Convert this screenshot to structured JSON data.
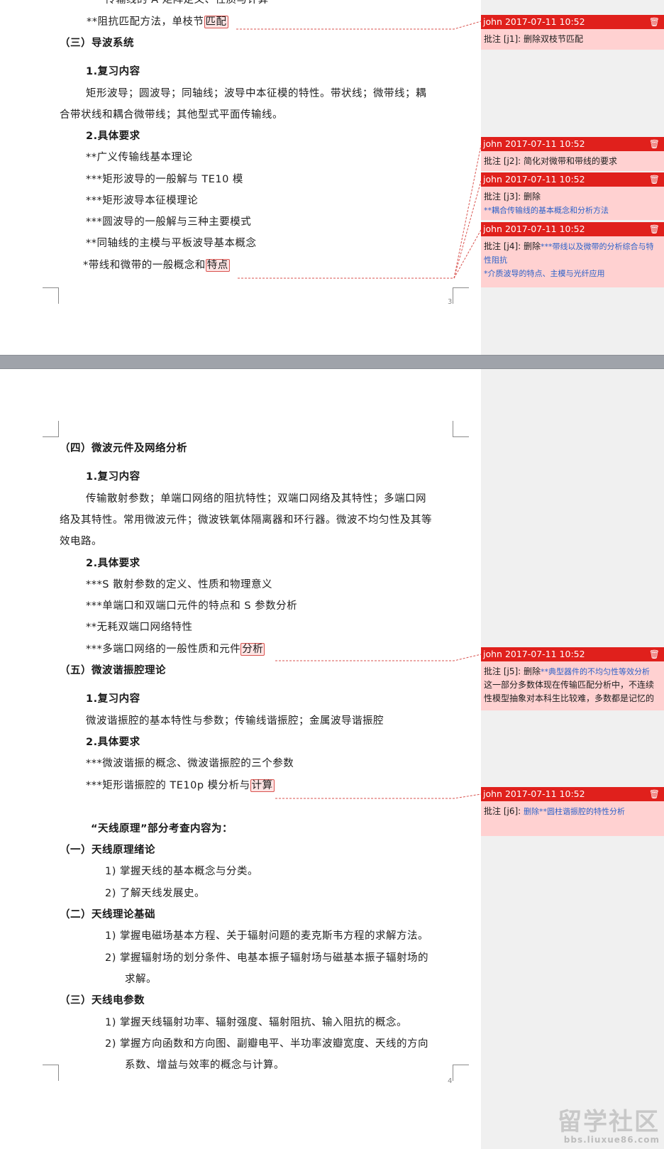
{
  "page1": {
    "lines": [
      "传输线的 A 矩阵定义、性质与计算",
      "**阻抗匹配方法，单枝节",
      "匹配",
      "（三）导波系统",
      "1.复习内容",
      "矩形波导；圆波导；同轴线；波导中本征模的特性。带状线；微带线；耦",
      "合带状线和耦合微带线；其他型式平面传输线。",
      "2.具体要求",
      "**广义传输线基本理论",
      "***矩形波导的一般解与 TE10 模",
      "***矩形波导本征模理论",
      "***圆波导的一般解与三种主要模式",
      "**同轴线的主模与平板波导基本概念",
      "*带线和微带的一般概念和",
      "特点"
    ],
    "page_number": "3"
  },
  "page2": {
    "lines": [
      "（四）微波元件及网络分析",
      "1.复习内容",
      "传输散射参数；单端口网络的阻抗特性；双端口网络及其特性；多端口网",
      "络及其特性。常用微波元件；微波铁氧体隔离器和环行器。微波不均匀性及其等",
      "效电路。",
      "2.具体要求",
      "***S 散射参数的定义、性质和物理意义",
      "***单端口和双端口元件的特点和 S 参数分析",
      "**无耗双端口网络特性",
      "***多端口网络的一般性质和元件",
      "分析",
      "（五）微波谐振腔理论",
      "1.复习内容",
      "微波谐振腔的基本特性与参数；传输线谐振腔；金属波导谐振腔",
      "2.具体要求",
      "***微波谐振的概念、微波谐振腔的三个参数",
      "***矩形谐振腔的 TE10p 模分析与",
      "计算",
      "“天线原理”部分考查内容为：",
      "（一）天线原理绪论",
      "1) 掌握天线的基本概念与分类。",
      "2) 了解天线发展史。",
      "（二）天线理论基础",
      "1) 掌握电磁场基本方程、关于辐射问题的麦克斯韦方程的求解方法。",
      "2) 掌握辐射场的划分条件、电基本振子辐射场与磁基本振子辐射场的",
      "求解。",
      "（三）天线电参数",
      "1) 掌握天线辐射功率、辐射强度、辐射阻抗、输入阻抗的概念。",
      "2) 掌握方向函数和方向图、副瓣电平、半功率波瓣宽度、天线的方向",
      "系数、增益与效率的概念与计算。"
    ],
    "page_number": "4"
  },
  "comments": [
    {
      "author": "john 2017-07-11 10:52",
      "tag": "批注 [j1]:",
      "text": "删除双枝节匹配",
      "blue": ""
    },
    {
      "author": "john 2017-07-11 10:52",
      "tag": "批注 [j2]:",
      "text": "简化对微带和带线的要求",
      "blue": ""
    },
    {
      "author": "john 2017-07-11 10:52",
      "tag": "批注 [j3]:",
      "text": "删除",
      "blue": "**耦合传输线的基本概念和分析方法"
    },
    {
      "author": "john 2017-07-11 10:52",
      "tag": "批注 [j4]:",
      "text": "删除",
      "blue": "***带线以及微带的分析综合与特性阻抗",
      "blue2": "*介质波导的特点、主模与光纤应用"
    },
    {
      "author": "john 2017-07-11 10:52",
      "tag": "批注 [j5]:",
      "text": "删除",
      "blue": "**典型器件的不均匀性等效分析",
      "extra": "这一部分多数体现在传输匹配分析中，不连续性模型抽象对本科生比较难，多数都是记忆的"
    },
    {
      "author": "john 2017-07-11 10:52",
      "tag": "批注 [j6]:",
      "text": "",
      "blue": "删除**圆柱谐振腔的特性分析"
    }
  ],
  "icons": {
    "delete": "trash-icon"
  },
  "watermark": {
    "big": "留学社区",
    "small": "bbs.liuxue86.com"
  },
  "colors": {
    "comment_header": "#e0201c",
    "comment_body": "#ffd1d1",
    "link_blue": "#2d62c9"
  }
}
